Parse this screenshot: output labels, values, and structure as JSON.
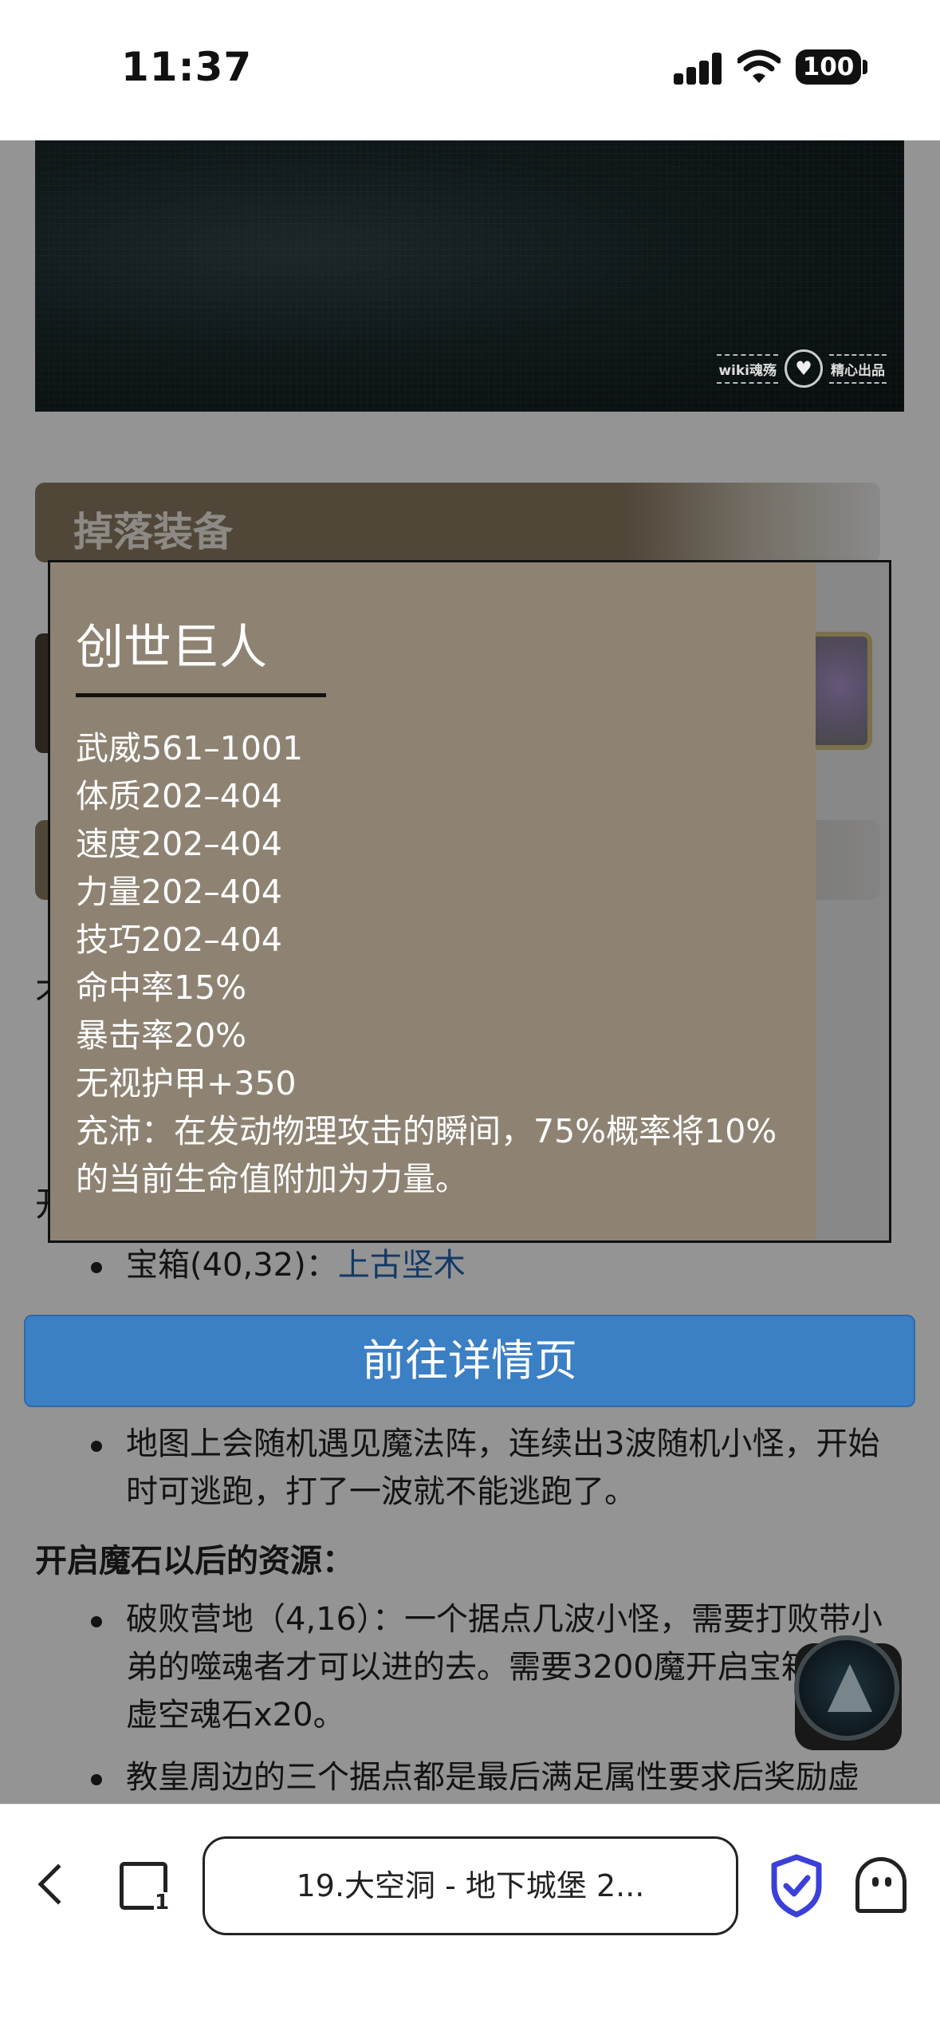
{
  "status_bar": {
    "time": "11:37",
    "battery": "100",
    "icons": [
      "signal-icon",
      "wifi-icon",
      "battery-icon"
    ]
  },
  "page": {
    "watermark_left": "wiki魂殇",
    "watermark_right": "精心出品",
    "section_header": "掉落装备",
    "fragment_left_a": "不",
    "fragment_left_b": "开",
    "list_1": [
      {
        "prefix": "宝箱(40,32)：",
        "link": "上古坚木"
      }
    ],
    "list_2": [
      {
        "text": "地图上会随机遇见魔法阵，连续出3波随机小怪，开始时可逃跑，打了一波就不能逃跑了。"
      }
    ],
    "after_stone_title": "开启魔石以后的资源：",
    "list_3": [
      {
        "text": "破败营地（4,16）：一个据点几波小怪，需要打败带小弟的噬魂者才可以进的去。需要3200魔开启宝箱奖励虚空魂石x20。"
      },
      {
        "text": "教皇周边的三个据点都是最后满足属性要求后奖励虚"
      }
    ]
  },
  "popup": {
    "title": "创世巨人",
    "stats": [
      "武威561–1001",
      "体质202–404",
      "速度202–404",
      "力量202–404",
      "技巧202–404",
      "命中率15%",
      "暴击率20%",
      "无视护甲+350"
    ],
    "description": "充沛：在发动物理攻击的瞬间，75%概率将10%的当前生命值附加为力量。"
  },
  "detail_button": "前往详情页",
  "toolbar": {
    "url_title": "19.大空洞 - 地下城堡 2...",
    "tabs_count": "1"
  },
  "colors": {
    "popup_panel": "#8e8373",
    "detail_button": "#3b7fc4",
    "link": "#1f62b0",
    "shield": "#3b40d9"
  }
}
